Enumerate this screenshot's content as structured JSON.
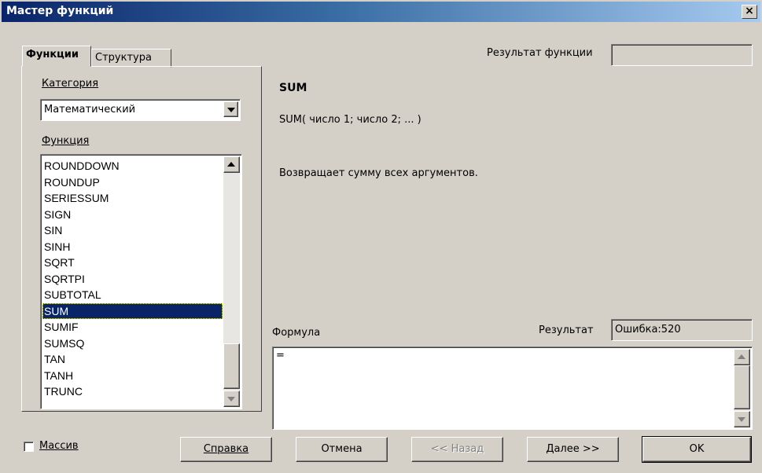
{
  "window": {
    "title": "Мастер функций",
    "close_label": "×"
  },
  "tabs": [
    {
      "label": "Функции",
      "active": true
    },
    {
      "label": "Структура",
      "active": false
    }
  ],
  "category": {
    "label": "Категория",
    "value": "Математический"
  },
  "function_list": {
    "label": "Функция",
    "items": [
      "ROUNDDOWN",
      "ROUNDUP",
      "SERIESSUM",
      "SIGN",
      "SIN",
      "SINH",
      "SQRT",
      "SQRTPI",
      "SUBTOTAL",
      "SUM",
      "SUMIF",
      "SUMSQ",
      "TAN",
      "TANH",
      "TRUNC"
    ],
    "selected": "SUM"
  },
  "function_info": {
    "name": "SUM",
    "signature": "SUM( число 1; число 2; ... )",
    "description": "Возвращает сумму всех аргументов."
  },
  "function_result": {
    "label": "Результат функции",
    "value": ""
  },
  "formula": {
    "label": "Формула",
    "value": "="
  },
  "result": {
    "label": "Результат",
    "value": "Ошибка:520"
  },
  "array_checkbox": {
    "label": "Массив",
    "checked": false
  },
  "buttons": {
    "help": "Справка",
    "cancel": "Отмена",
    "back": "<< Назад",
    "next": "Далее >>",
    "ok": "OK"
  }
}
